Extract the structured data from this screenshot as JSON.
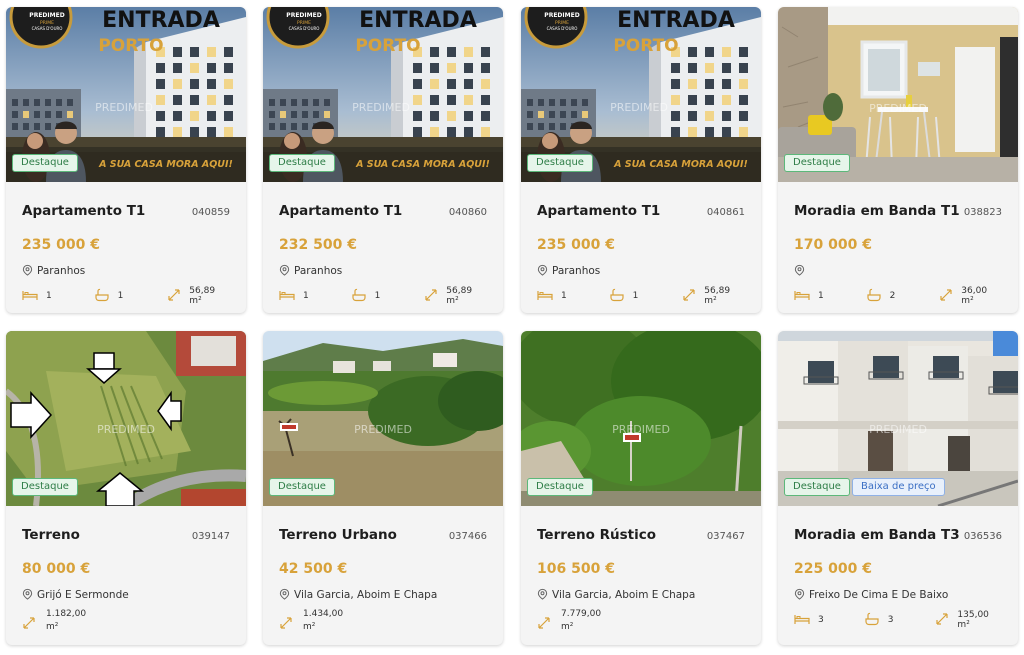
{
  "listings": [
    {
      "title": "Apartamento T1",
      "ref": "040859",
      "price": "235 000 €",
      "location": "Paranhos",
      "beds": "1",
      "baths": "1",
      "area": "56,89 m²",
      "badge": "Destaque",
      "image": "porto-banner"
    },
    {
      "title": "Apartamento T1",
      "ref": "040860",
      "price": "232 500 €",
      "location": "Paranhos",
      "beds": "1",
      "baths": "1",
      "area": "56,89 m²",
      "badge": "Destaque",
      "image": "porto-banner"
    },
    {
      "title": "Apartamento T1",
      "ref": "040861",
      "price": "235 000 €",
      "location": "Paranhos",
      "beds": "1",
      "baths": "1",
      "area": "56,89 m²",
      "badge": "Destaque",
      "image": "porto-banner"
    },
    {
      "title": "Moradia em Banda T1",
      "ref": "038823",
      "price": "170 000 €",
      "location": "",
      "beds": "1",
      "baths": "2",
      "area": "36,00 m²",
      "badge": "Destaque",
      "image": "interior"
    },
    {
      "title": "Terreno",
      "ref": "039147",
      "price": "80 000 €",
      "location": "Grijó E Sermonde",
      "area_line1": "1.182,00",
      "area_line2": "m²",
      "badge": "Destaque",
      "image": "aerial"
    },
    {
      "title": "Terreno Urbano",
      "ref": "037466",
      "price": "42 500 €",
      "location": "Vila Garcia, Aboim E Chapa",
      "area_line1": "1.434,00",
      "area_line2": "m²",
      "badge": "Destaque",
      "image": "field"
    },
    {
      "title": "Terreno Rústico",
      "ref": "037467",
      "price": "106 500 €",
      "location": "Vila Garcia, Aboim E Chapa",
      "area_line1": "7.779,00",
      "area_line2": "m²",
      "badge": "Destaque",
      "image": "trees"
    },
    {
      "title": "Moradia em Banda T3",
      "ref": "036536",
      "price": "225 000 €",
      "location": "Freixo De Cima E De Baixo",
      "beds": "3",
      "baths": "3",
      "area": "135,00 m²",
      "badge": "Destaque",
      "badge2": "Baixa de preço",
      "image": "townhouse"
    }
  ],
  "banner": {
    "headline": "ENTRADA",
    "city": "PORTO",
    "tagline": "A SUA CASA MORA AQUI!",
    "logo_top": "PREDIMED",
    "logo_mid": "PRIME",
    "logo_bottom": "CASAS D'OURO"
  },
  "watermark": "PREDIMED",
  "colors": {
    "price": "#d8a23a",
    "badge_green": "#5cb87a",
    "badge_blue": "#8fb1e6",
    "card_bg": "#f4f4f4"
  },
  "icons": {
    "location": "map-pin-icon",
    "beds": "bed-icon",
    "baths": "bathtub-icon",
    "area": "area-arrows-icon"
  }
}
